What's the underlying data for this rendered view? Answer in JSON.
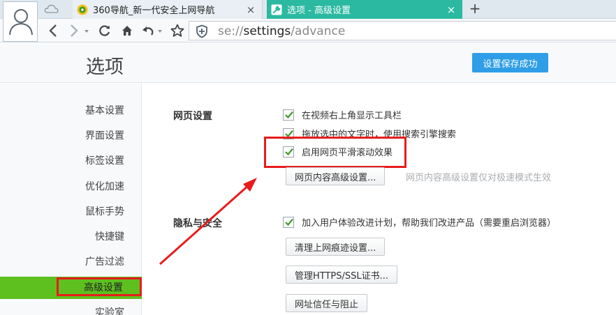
{
  "tabs": [
    {
      "title": "360导航_新一代安全上网导航",
      "close": "×"
    },
    {
      "title": "选项 - 高级设置",
      "close": "×"
    }
  ],
  "new_tab": "+",
  "address": {
    "scheme": "se://",
    "host": "settings",
    "path": "/advance"
  },
  "header": {
    "title": "选项",
    "save_status": "设置保存成功"
  },
  "sidebar": {
    "items": [
      {
        "label": "基本设置"
      },
      {
        "label": "界面设置"
      },
      {
        "label": "标签设置"
      },
      {
        "label": "优化加速"
      },
      {
        "label": "鼠标手势"
      },
      {
        "label": "快捷键"
      },
      {
        "label": "广告过滤"
      },
      {
        "label": "高级设置",
        "active": true
      },
      {
        "label": "实验室"
      }
    ]
  },
  "sections": {
    "web": {
      "title": "网页设置",
      "options": [
        {
          "label": "在视频右上角显示工具栏",
          "checked": true
        },
        {
          "label": "拖放选中的文字时，使用搜索引擎搜索",
          "checked": true
        },
        {
          "label": "启用网页平滑滚动效果",
          "checked": true
        }
      ],
      "advanced_button": "网页内容高级设置...",
      "advanced_hint": "网页内容高级设置仅对极速模式生效"
    },
    "privacy": {
      "title": "隐私与安全",
      "options": [
        {
          "label": "加入用户体验改进计划，帮助我们改进产品（需要重启浏览器）",
          "checked": true
        }
      ],
      "buttons": {
        "clear": "清理上网痕迹设置...",
        "certs": "管理HTTPS/SSL证书...",
        "trust": "网址信任与阻止"
      }
    }
  },
  "colors": {
    "active_tab": "#2bb9a1",
    "sidebar_active": "#5dc01f",
    "save_badge": "#2f9ee6",
    "annotation": "#e81c1c",
    "checkmark": "#3c9a28"
  },
  "icons": [
    "user-avatar-icon",
    "cloud-icon",
    "360-logo-icon",
    "wrench-icon",
    "back-icon",
    "forward-icon",
    "refresh-icon",
    "home-icon",
    "undo-icon",
    "star-icon",
    "shield-icon",
    "checkbox-check-icon",
    "annotation-arrow"
  ]
}
